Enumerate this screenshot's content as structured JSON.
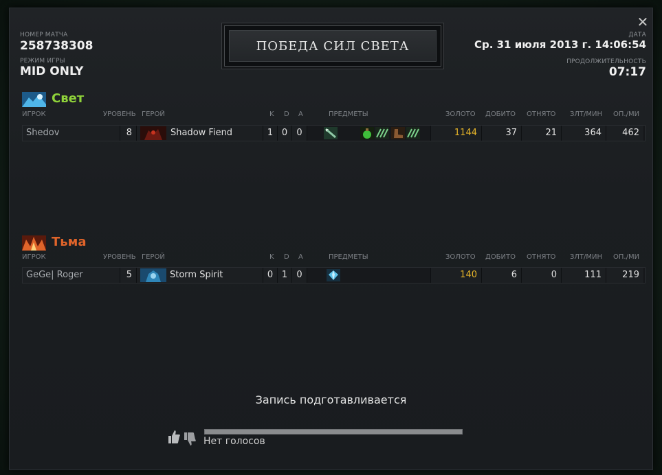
{
  "window": {
    "close_symbol": "✕",
    "title": "ПОБЕДА СИЛ СВЕТА"
  },
  "match": {
    "id_label": "НОМЕР МАТЧА",
    "id": "258738308",
    "mode_label": "РЕЖИМ ИГРЫ",
    "mode": "MID ONLY",
    "date_label": "ДАТА",
    "date": "Ср. 31 июля 2013 г. 14:06:54",
    "duration_label": "ПРОДОЛЖИТЕЛЬНОСТЬ",
    "duration": "07:17"
  },
  "columns": {
    "player": "ИГРОК",
    "level": "УРОВЕНЬ",
    "hero": "ГЕРОЙ",
    "k": "K",
    "d": "D",
    "a": "A",
    "items": "ПРЕДМЕТЫ",
    "gold": "ЗОЛОТО",
    "last_hits": "ДОБИТО",
    "denies": "ОТНЯТО",
    "gpm": "ЗЛТ/МИН",
    "xpm": "ОП./МИ"
  },
  "radiant": {
    "name": "Свет",
    "color": "#8fd23a",
    "player": {
      "name": "Shedov",
      "level": "8",
      "hero": "Shadow Fiend",
      "kills": "1",
      "deaths": "0",
      "assists": "0",
      "gold": "1144",
      "last_hits": "37",
      "denies": "21",
      "gpm": "364",
      "xpm": "462",
      "items": [
        "sword-icon",
        "empty",
        "potion-icon",
        "claw-icon",
        "boots-icon",
        "claw-icon"
      ]
    }
  },
  "dire": {
    "name": "Тьма",
    "color": "#e0642a",
    "player": {
      "name": "GeGe| Roger",
      "level": "5",
      "hero": "Storm Spirit",
      "kills": "0",
      "deaths": "1",
      "assists": "0",
      "gold": "140",
      "last_hits": "6",
      "denies": "0",
      "gpm": "111",
      "xpm": "219",
      "items": [
        "crystal-icon"
      ]
    }
  },
  "replay_status": "Запись подготавливается",
  "votes": {
    "text": "Нет голосов"
  },
  "colors": {
    "gold": "#e7b529"
  }
}
